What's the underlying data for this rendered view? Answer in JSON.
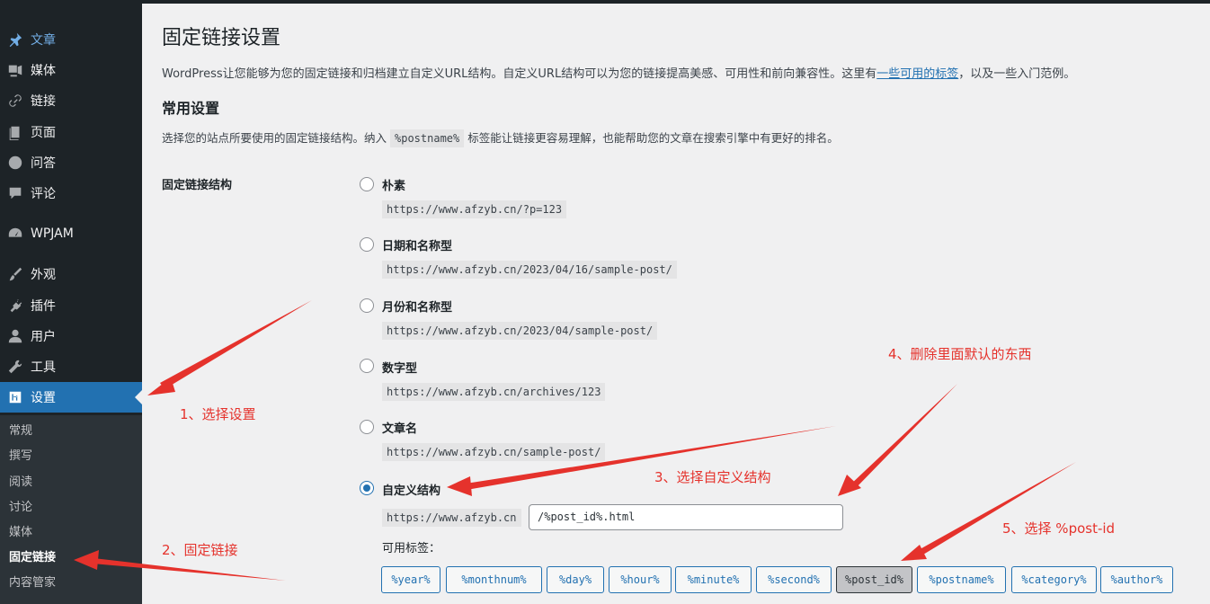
{
  "sidebar": {
    "items": [
      {
        "label": "文章",
        "icon": "pin-icon"
      },
      {
        "label": "媒体",
        "icon": "media-icon"
      },
      {
        "label": "链接",
        "icon": "link-icon"
      },
      {
        "label": "页面",
        "icon": "page-icon"
      },
      {
        "label": "问答",
        "icon": "question-icon"
      },
      {
        "label": "评论",
        "icon": "comment-icon"
      },
      {
        "label": "WPJAM",
        "icon": "gauge-icon"
      },
      {
        "label": "外观",
        "icon": "brush-icon"
      },
      {
        "label": "插件",
        "icon": "plugin-icon"
      },
      {
        "label": "用户",
        "icon": "user-icon"
      },
      {
        "label": "工具",
        "icon": "wrench-icon"
      },
      {
        "label": "设置",
        "icon": "settings-icon"
      }
    ],
    "submenu": [
      "常规",
      "撰写",
      "阅读",
      "讨论",
      "媒体",
      "固定链接",
      "内容管家"
    ]
  },
  "page": {
    "title": "固定链接设置",
    "desc_before": "WordPress让您能够为您的固定链接和归档建立自定义URL结构。自定义URL结构可以为您的链接提高美感、可用性和前向兼容性。这里有",
    "desc_link": "一些可用的标签",
    "desc_after": "，以及一些入门范例。",
    "section_title": "常用设置",
    "section_desc_before": "选择您的站点所要使用的固定链接结构。纳入",
    "section_desc_code": "%postname%",
    "section_desc_after": "标签能让链接更容易理解，也能帮助您的文章在搜索引擎中有更好的排名。",
    "structure_label": "固定链接结构"
  },
  "options": [
    {
      "label": "朴素",
      "example": "https://www.afzyb.cn/?p=123"
    },
    {
      "label": "日期和名称型",
      "example": "https://www.afzyb.cn/2023/04/16/sample-post/"
    },
    {
      "label": "月份和名称型",
      "example": "https://www.afzyb.cn/2023/04/sample-post/"
    },
    {
      "label": "数字型",
      "example": "https://www.afzyb.cn/archives/123"
    },
    {
      "label": "文章名",
      "example": "https://www.afzyb.cn/sample-post/"
    },
    {
      "label": "自定义结构",
      "example": ""
    }
  ],
  "custom": {
    "base": "https://www.afzyb.cn",
    "value": "/%post_id%.html",
    "tags_label": "可用标签：",
    "tags": [
      "%year%",
      "%monthnum%",
      "%day%",
      "%hour%",
      "%minute%",
      "%second%",
      "%post_id%",
      "%postname%",
      "%category%",
      "%author%"
    ]
  },
  "annotations": {
    "note1": "1、选择设置",
    "note2": "2、固定链接",
    "note3": "3、选择自定义结构",
    "note4": "4、删除里面默认的东西",
    "note5": "5、选择  %post-id"
  },
  "colors": {
    "accent": "#2271b1",
    "annotation": "#e5322c",
    "sidebar": "#1d2327"
  }
}
